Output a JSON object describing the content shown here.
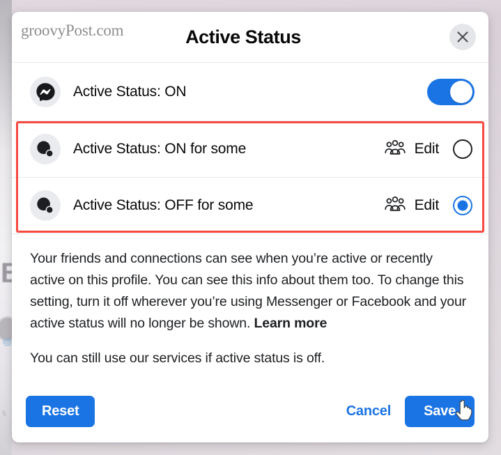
{
  "backdrop": {
    "letter": "B",
    "small_text": "s"
  },
  "modal": {
    "watermark": "groovyPost.com",
    "title": "Active Status",
    "close_icon": "close-icon",
    "options": [
      {
        "icon": "messenger-icon",
        "label": "Active Status: ON",
        "control": "toggle",
        "toggle_on": true,
        "has_edit": false,
        "edit_label": "",
        "people_icon": ""
      },
      {
        "icon": "people-avatar-icon",
        "label": "Active Status: ON for some",
        "control": "radio",
        "selected": false,
        "has_edit": true,
        "edit_label": "Edit",
        "people_icon": "people-group-icon"
      },
      {
        "icon": "people-avatar-icon",
        "label": "Active Status: OFF for some",
        "control": "radio",
        "selected": true,
        "has_edit": true,
        "edit_label": "Edit",
        "people_icon": "people-group-icon"
      }
    ],
    "body": {
      "paragraph_1_before_link": "Your friends and connections can see when you’re active or recently active on this profile. You can see this info about them too. To change this setting, turn it off wherever you’re using Messenger or Facebook and your active status will no longer be shown. ",
      "learn_more": "Learn more",
      "paragraph_2": "You can still use our services if active status is off."
    },
    "footer": {
      "reset_label": "Reset",
      "cancel_label": "Cancel",
      "save_label": "Save"
    }
  },
  "colors": {
    "accent_blue": "#1b74e4",
    "highlight_red": "#f8483f",
    "text_primary": "#1c1e21",
    "avatar_bg": "#e9ebee",
    "page_bg": "#ded4dc"
  }
}
